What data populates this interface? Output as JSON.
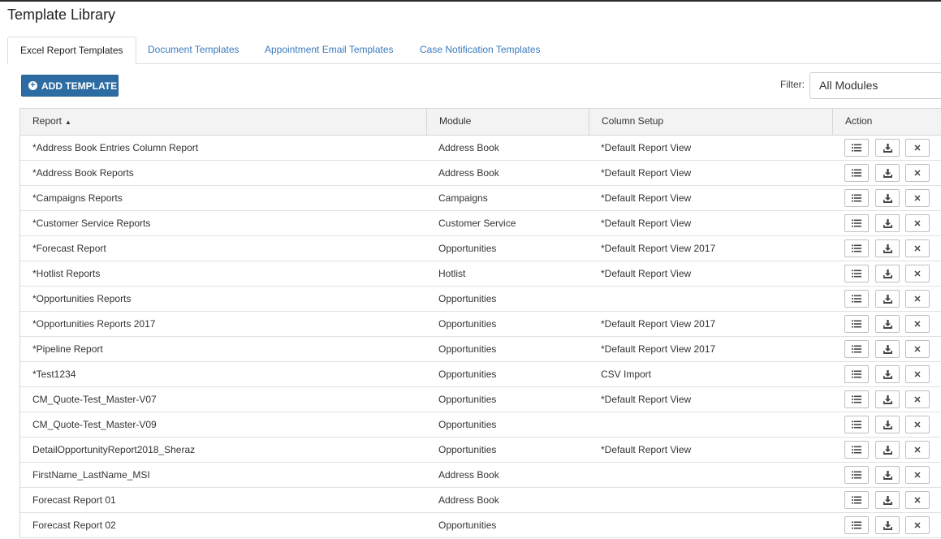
{
  "page": {
    "title": "Template Library"
  },
  "tabs": [
    {
      "label": "Excel Report Templates",
      "active": true
    },
    {
      "label": "Document Templates",
      "active": false
    },
    {
      "label": "Appointment Email Templates",
      "active": false
    },
    {
      "label": "Case Notification Templates",
      "active": false
    }
  ],
  "toolbar": {
    "add_label": "ADD TEMPLATE",
    "filter_label": "Filter:",
    "filter_value": "All Modules"
  },
  "table": {
    "columns": [
      "Report",
      "Module",
      "Column Setup",
      "Action"
    ],
    "sort": {
      "column": "Report",
      "direction": "ascending"
    },
    "rows": [
      {
        "report": "*Address Book Entries Column Report",
        "module": "Address Book",
        "column_setup": "*Default Report View"
      },
      {
        "report": "*Address Book Reports",
        "module": "Address Book",
        "column_setup": "*Default Report View"
      },
      {
        "report": "*Campaigns Reports",
        "module": "Campaigns",
        "column_setup": "*Default Report View"
      },
      {
        "report": "*Customer Service Reports",
        "module": "Customer Service",
        "column_setup": "*Default Report View"
      },
      {
        "report": "*Forecast Report",
        "module": "Opportunities",
        "column_setup": "*Default Report View 2017"
      },
      {
        "report": "*Hotlist Reports",
        "module": "Hotlist",
        "column_setup": "*Default Report View"
      },
      {
        "report": "*Opportunities Reports",
        "module": "Opportunities",
        "column_setup": ""
      },
      {
        "report": "*Opportunities Reports 2017",
        "module": "Opportunities",
        "column_setup": "*Default Report View 2017"
      },
      {
        "report": "*Pipeline Report",
        "module": "Opportunities",
        "column_setup": "*Default Report View 2017"
      },
      {
        "report": "*Test1234",
        "module": "Opportunities",
        "column_setup": "CSV Import"
      },
      {
        "report": "CM_Quote-Test_Master-V07",
        "module": "Opportunities",
        "column_setup": "*Default Report View"
      },
      {
        "report": "CM_Quote-Test_Master-V09",
        "module": "Opportunities",
        "column_setup": ""
      },
      {
        "report": "DetailOpportunityReport2018_Sheraz",
        "module": "Opportunities",
        "column_setup": "*Default Report View"
      },
      {
        "report": "FirstName_LastName_MSI",
        "module": "Address Book",
        "column_setup": ""
      },
      {
        "report": "Forecast Report 01",
        "module": "Address Book",
        "column_setup": ""
      },
      {
        "report": "Forecast Report 02",
        "module": "Opportunities",
        "column_setup": ""
      }
    ],
    "row_actions": [
      "list-icon",
      "download-icon",
      "close-icon"
    ]
  },
  "colors": {
    "accent": "#2d6ca2",
    "tab_link": "#3a7bbf",
    "header_bg": "#f3f3f3",
    "border": "#d6d6d6"
  }
}
